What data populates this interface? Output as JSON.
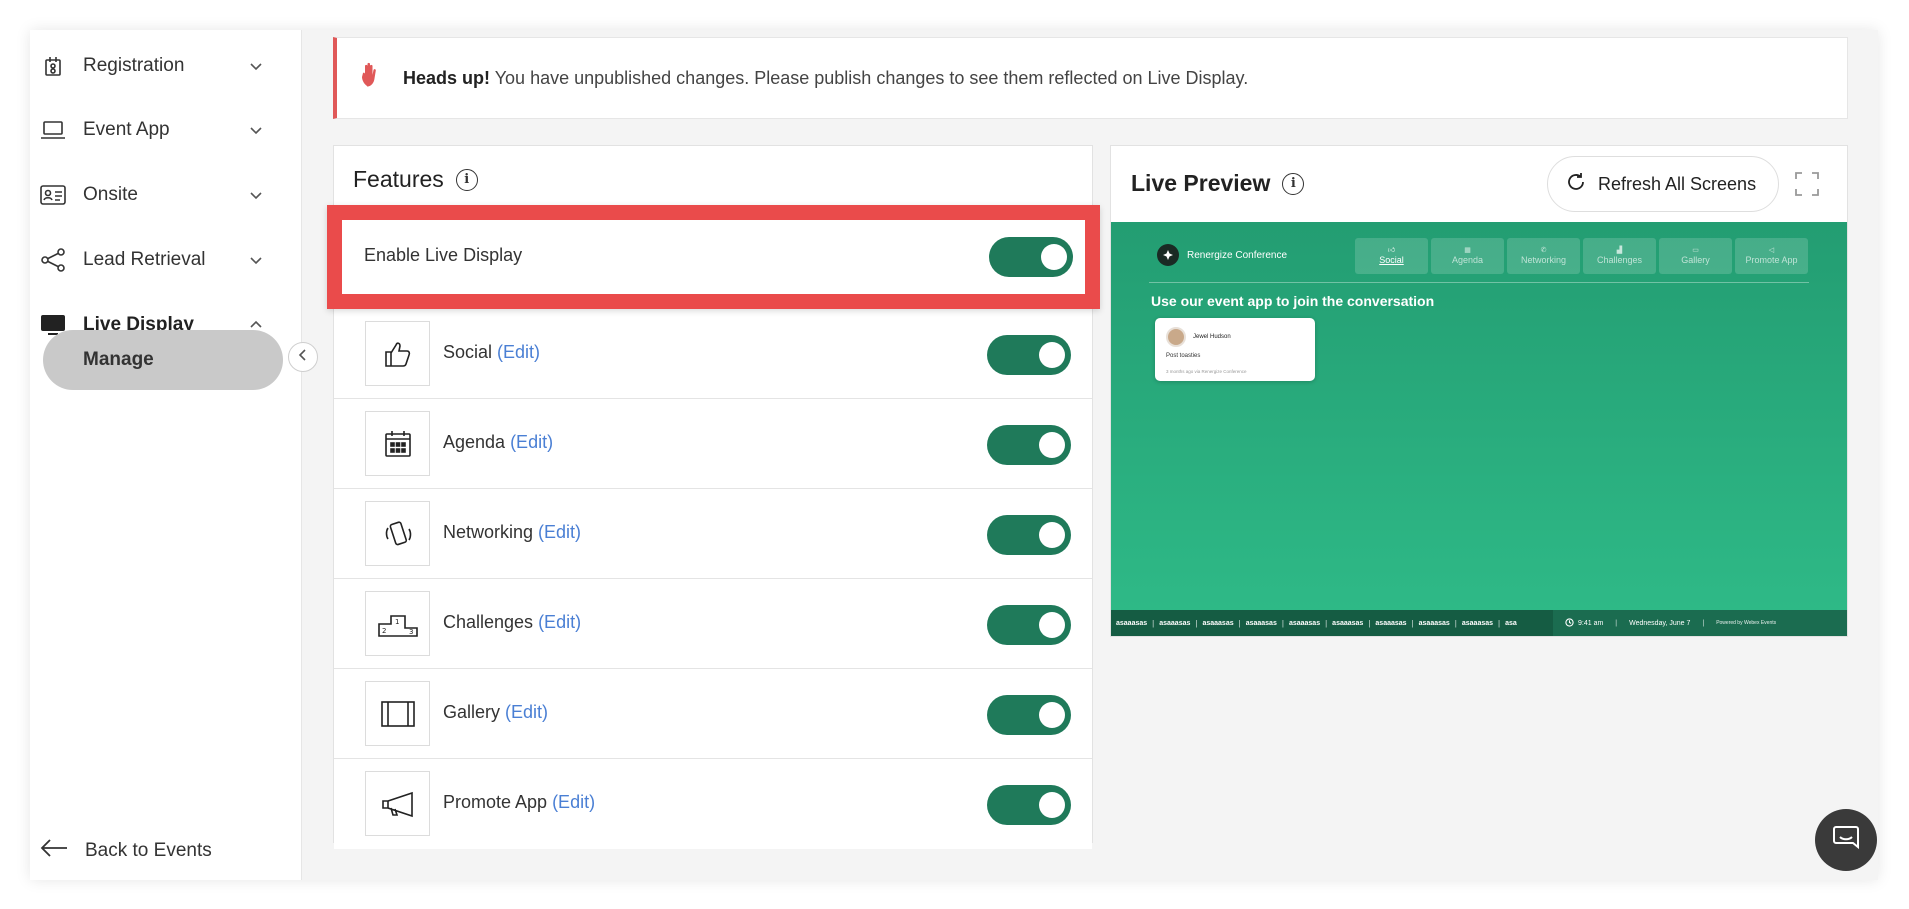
{
  "sidebar": {
    "items": [
      {
        "label": "Registration",
        "icon": "registration-icon"
      },
      {
        "label": "Event App",
        "icon": "laptop-icon"
      },
      {
        "label": "Onsite",
        "icon": "id-card-icon"
      },
      {
        "label": "Lead Retrieval",
        "icon": "share-icon"
      },
      {
        "label": "Live Display",
        "icon": "monitor-icon"
      }
    ],
    "active_sub": "Manage",
    "back_label": "Back to Events"
  },
  "alert": {
    "bold": "Heads up!",
    "message": " You have unpublished changes. Please publish changes to see them reflected on Live Display."
  },
  "features": {
    "title": "Features",
    "enable_label": "Enable Live Display",
    "enable_on": true,
    "edit_label": "(Edit)",
    "items": [
      {
        "name": "Social",
        "icon": "thumbs-up-icon",
        "on": true
      },
      {
        "name": "Agenda",
        "icon": "calendar-icon",
        "on": true
      },
      {
        "name": "Networking",
        "icon": "phone-vibrate-icon",
        "on": true
      },
      {
        "name": "Challenges",
        "icon": "podium-icon",
        "on": true
      },
      {
        "name": "Gallery",
        "icon": "gallery-icon",
        "on": true
      },
      {
        "name": "Promote App",
        "icon": "megaphone-icon",
        "on": true
      }
    ]
  },
  "preview": {
    "title": "Live Preview",
    "refresh_label": "Refresh All Screens",
    "screen": {
      "brand": "Renergize Conference",
      "tabs": [
        "Social",
        "Agenda",
        "Networking",
        "Challenges",
        "Gallery",
        "Promote App"
      ],
      "active_tab": "Social",
      "headline": "Use our event app to join the conversation",
      "post": {
        "author": "Jewel Hudson",
        "text": "Post toasties",
        "time": "3 months ago via Renergize Conference"
      },
      "ticker_items": [
        "asaaasas",
        "asaaasas",
        "asaaasas",
        "asaaasas",
        "asaaasas",
        "asaaasas",
        "asaaasas",
        "asaaasas",
        "asaaasas",
        "asa"
      ],
      "clock": "9:41 am",
      "date": "Wednesday, June 7",
      "powered_by": "Powered by Webex Events"
    }
  },
  "colors": {
    "toggle_on": "#1f7a5a",
    "highlight": "#ea4b4b",
    "link": "#4a7fd4",
    "screen_green": "#2fbb88"
  }
}
